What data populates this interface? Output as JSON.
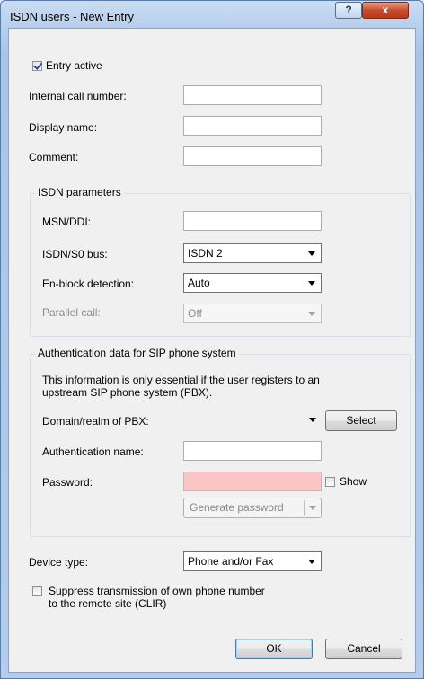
{
  "window": {
    "title": "ISDN users - New Entry",
    "help_label": "?",
    "close_label": "x"
  },
  "general": {
    "entry_active_label": "Entry active",
    "entry_active_checked": true,
    "internal_call_number_label": "Internal call number:",
    "internal_call_number_value": "",
    "display_name_label": "Display name:",
    "display_name_value": "",
    "comment_label": "Comment:",
    "comment_value": ""
  },
  "isdn_params": {
    "group_label": "ISDN parameters",
    "msn_ddi_label": "MSN/DDI:",
    "msn_ddi_value": "",
    "bus_label": "ISDN/S0 bus:",
    "bus_value": "ISDN 2",
    "enblock_label": "En-block detection:",
    "enblock_value": "Auto",
    "parallel_label": "Parallel call:",
    "parallel_value": "Off"
  },
  "auth": {
    "group_label": "Authentication data for SIP phone system",
    "info_line1": "This information is only essential if the user registers to an",
    "info_line2": "upstream SIP phone system (PBX).",
    "domain_label": "Domain/realm of PBX:",
    "domain_value": "",
    "select_button": "Select",
    "auth_name_label": "Authentication name:",
    "auth_name_value": "",
    "password_label": "Password:",
    "password_value": "",
    "show_label": "Show",
    "show_checked": false,
    "generate_password_button": "Generate password"
  },
  "device": {
    "device_type_label": "Device type:",
    "device_type_value": "Phone and/or Fax",
    "clir_label_line1": "Suppress transmission of own phone number",
    "clir_label_line2": "to the remote site (CLIR)",
    "clir_checked": false
  },
  "buttons": {
    "ok": "OK",
    "cancel": "Cancel"
  },
  "colors": {
    "password_invalid_bg": "#fbc5c5",
    "titlebar_close": "#c84b2c"
  }
}
